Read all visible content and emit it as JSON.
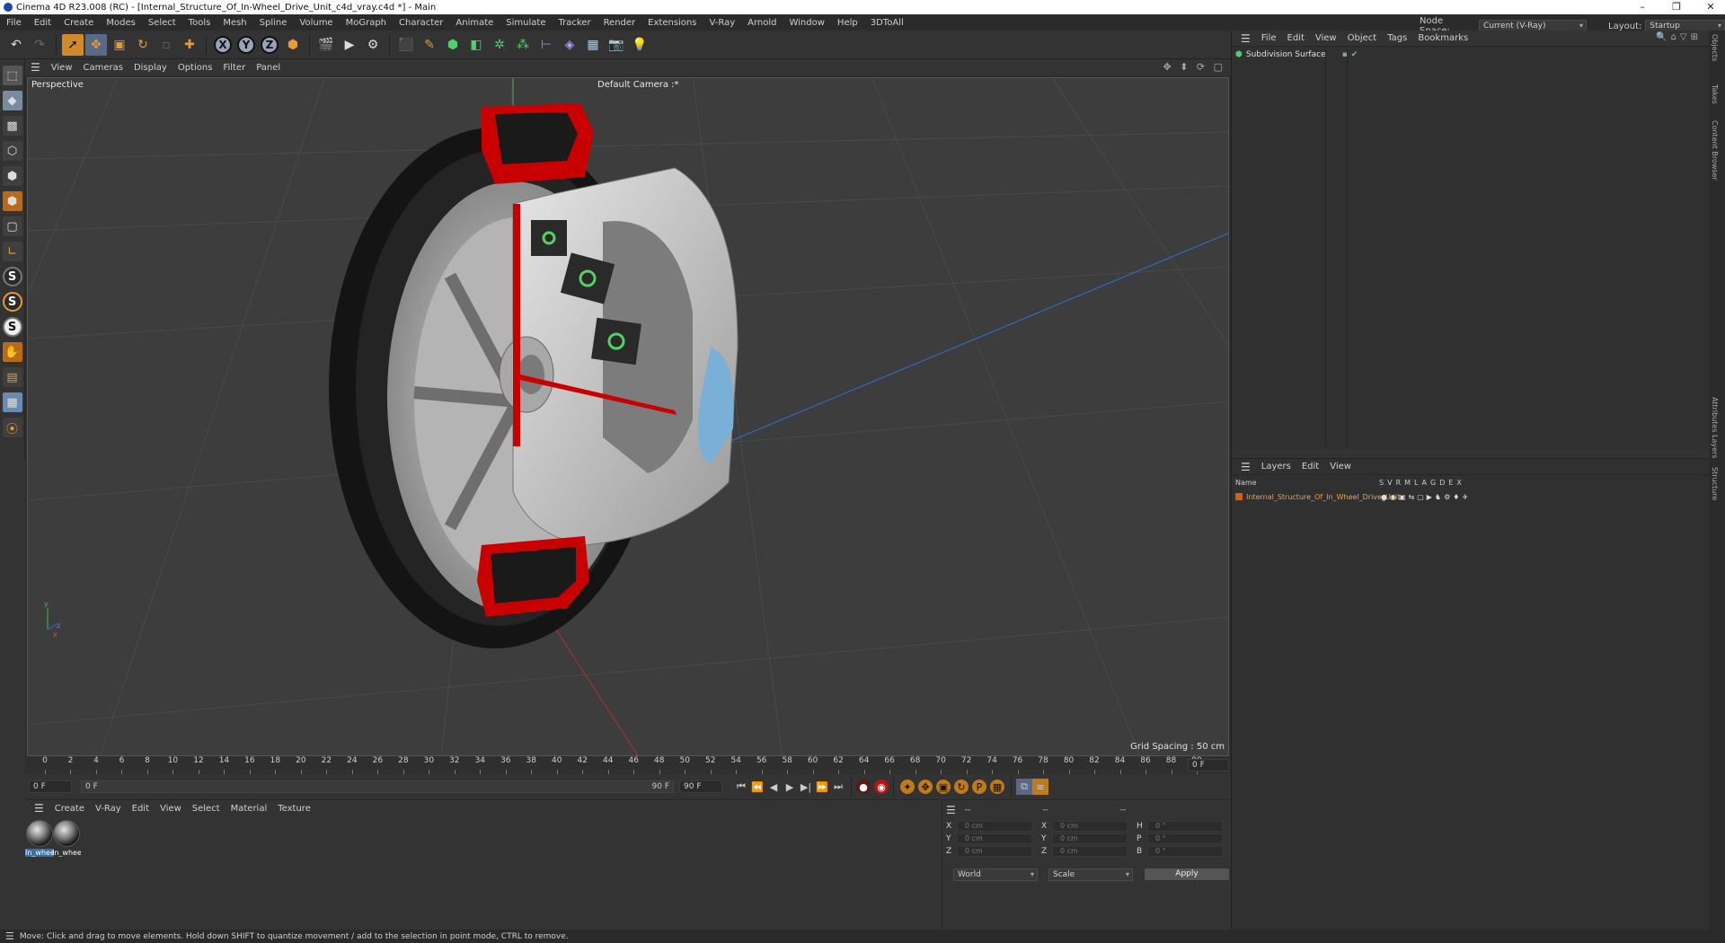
{
  "window": {
    "title": "Cinema 4D R23.008 (RC) - [Internal_Structure_Of_In-Wheel_Drive_Unit_c4d_vray.c4d *] - Main",
    "minimize": "–",
    "restore": "❐",
    "close": "✕"
  },
  "menubar": {
    "items": [
      "File",
      "Edit",
      "Create",
      "Modes",
      "Select",
      "Tools",
      "Mesh",
      "Spline",
      "Volume",
      "MoGraph",
      "Character",
      "Animate",
      "Simulate",
      "Tracker",
      "Render",
      "Extensions",
      "V-Ray",
      "Arnold",
      "Window",
      "Help",
      "3DToAll"
    ],
    "node_space_label": "Node Space:",
    "node_space_value": "Current (V-Ray)",
    "layout_label": "Layout:",
    "layout_value": "Startup"
  },
  "toolbar": {
    "axis_x": "X",
    "axis_y": "Y",
    "axis_z": "Z"
  },
  "lefttools": {
    "s_label": "S"
  },
  "viewport": {
    "menu": [
      "View",
      "Cameras",
      "Display",
      "Options",
      "Filter",
      "Panel"
    ],
    "label": "Perspective",
    "camera": "Default Camera :*",
    "grid_spacing": "Grid Spacing : 50 cm",
    "nav_icons": "✥ ⬍ ⟳ ▢"
  },
  "timeline": {
    "ticks": [
      "0",
      "2",
      "4",
      "6",
      "8",
      "10",
      "12",
      "14",
      "16",
      "18",
      "20",
      "22",
      "24",
      "26",
      "28",
      "30",
      "32",
      "34",
      "36",
      "38",
      "40",
      "42",
      "44",
      "46",
      "48",
      "50",
      "52",
      "54",
      "56",
      "58",
      "60",
      "62",
      "64",
      "66",
      "68",
      "70",
      "72",
      "74",
      "76",
      "78",
      "80",
      "82",
      "84",
      "86",
      "88",
      "90"
    ],
    "current_frame_right": "0 F"
  },
  "playbar": {
    "start": "0 F",
    "slider_start": "0 F",
    "slider_end": "90 F",
    "end": "90 F"
  },
  "material": {
    "menu": [
      "Create",
      "V-Ray",
      "Edit",
      "View",
      "Select",
      "Material",
      "Texture"
    ],
    "items": [
      {
        "name": "In_wheel",
        "selected": true
      },
      {
        "name": "In_wheel",
        "selected": false
      }
    ]
  },
  "coords": {
    "header": [
      "--",
      "--",
      "--"
    ],
    "rows": [
      {
        "a": "X",
        "av": "0 cm",
        "b": "X",
        "bv": "0 cm",
        "c": "H",
        "cv": "0 °"
      },
      {
        "a": "Y",
        "av": "0 cm",
        "b": "Y",
        "bv": "0 cm",
        "c": "P",
        "cv": "0 °"
      },
      {
        "a": "Z",
        "av": "0 cm",
        "b": "Z",
        "bv": "0 cm",
        "c": "B",
        "cv": "0 °"
      }
    ],
    "world": "World",
    "scale": "Scale",
    "apply": "Apply"
  },
  "status": "Move: Click and drag to move elements. Hold down SHIFT to quantize movement / add to the selection in point mode, CTRL to remove.",
  "objects": {
    "menu": [
      "File",
      "Edit",
      "View",
      "Object",
      "Tags",
      "Bookmarks"
    ],
    "item": "Subdivision Surface"
  },
  "layers": {
    "menu": [
      "Layers",
      "Edit",
      "View"
    ],
    "name_col": "Name",
    "flags": [
      "S",
      "V",
      "R",
      "M",
      "L",
      "A",
      "G",
      "D",
      "E",
      "X"
    ],
    "item": "Internal_Structure_Of_In_Wheel_Drive_Unit"
  },
  "vtabs": [
    "Objects",
    "Takes",
    "Content Browser",
    "Attributes",
    "Layers",
    "Structure"
  ],
  "colors": {
    "accent": "#3a6ea5",
    "layer_text": "#e8a060",
    "cut_red": "#c80000"
  }
}
